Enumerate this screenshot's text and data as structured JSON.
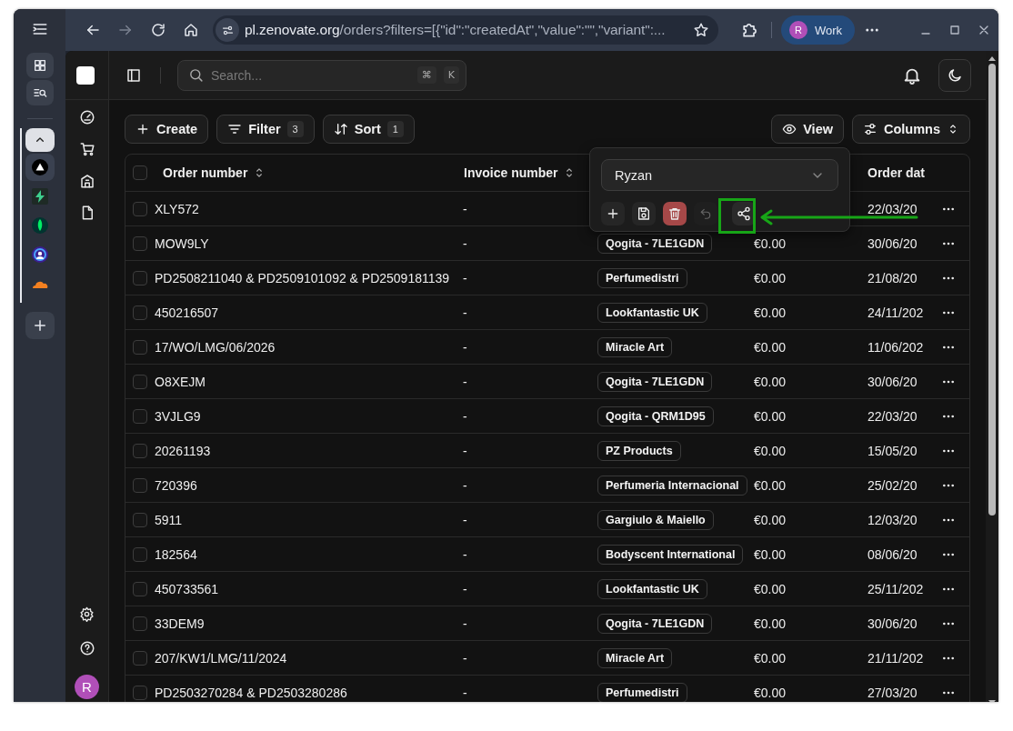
{
  "browser": {
    "forward_disabled": true,
    "url": {
      "host": "pl.zenovate.org",
      "rest": "/orders?filters=[{\"id\":\"createdAt\",\"value\":\"\",\"variant\":..."
    },
    "profile": {
      "initial": "R",
      "label": "Work"
    }
  },
  "side_panel": {
    "apps": [
      {
        "kind": "triangle",
        "selected": true
      },
      {
        "kind": "bolt",
        "selected": false
      },
      {
        "kind": "leaf",
        "selected": false
      },
      {
        "kind": "ring",
        "selected": false
      },
      {
        "kind": "cloud",
        "selected": false
      }
    ]
  },
  "app_sidebar": {
    "user_initial": "R"
  },
  "search": {
    "placeholder": "Search...",
    "keys": [
      "⌘",
      "K"
    ]
  },
  "toolbar": {
    "create": "Create",
    "filter": {
      "label": "Filter",
      "count": "3"
    },
    "sort": {
      "label": "Sort",
      "count": "1"
    },
    "view": "View",
    "columns": "Columns"
  },
  "table": {
    "all_checked": false,
    "header": {
      "order_number": "Order number",
      "invoice_number": "Invoice number",
      "column_5": "Order dat"
    },
    "rows": [
      {
        "order": "XLY572",
        "invoice": "-",
        "date": "22/03/20",
        "checked": false
      },
      {
        "order": "MOW9LY",
        "invoice": "-",
        "supplier": "Qogita - 7LE1GDN",
        "amount": "€0.00",
        "date": "30/06/20",
        "checked": false
      },
      {
        "order": "PD2508211040 & PD2509101092 & PD2509181139",
        "invoice": "-",
        "supplier": "Perfumedistri",
        "amount": "€0.00",
        "date": "21/08/20",
        "checked": false
      },
      {
        "order": "450216507",
        "invoice": "-",
        "supplier": "Lookfantastic UK",
        "amount": "€0.00",
        "date": "24/11/202",
        "checked": false
      },
      {
        "order": "17/WO/LMG/06/2026",
        "invoice": "-",
        "supplier": "Miracle Art",
        "amount": "€0.00",
        "date": "11/06/202",
        "checked": false
      },
      {
        "order": "O8XEJM",
        "invoice": "-",
        "supplier": "Qogita - 7LE1GDN",
        "amount": "€0.00",
        "date": "30/06/20",
        "checked": false
      },
      {
        "order": "3VJLG9",
        "invoice": "-",
        "supplier": "Qogita - QRM1D95",
        "amount": "€0.00",
        "date": "22/03/20",
        "checked": false
      },
      {
        "order": "20261193",
        "invoice": "-",
        "supplier": "PZ Products",
        "amount": "€0.00",
        "date": "15/05/20",
        "checked": false
      },
      {
        "order": "720396",
        "invoice": "-",
        "supplier": "Perfumeria Internacional",
        "amount": "€0.00",
        "date": "25/02/20",
        "checked": false
      },
      {
        "order": "5911",
        "invoice": "-",
        "supplier": "Gargiulo & Maiello",
        "amount": "€0.00",
        "date": "12/03/20",
        "checked": false
      },
      {
        "order": "182564",
        "invoice": "-",
        "supplier": "Bodyscent International",
        "amount": "€0.00",
        "date": "08/06/20",
        "checked": false
      },
      {
        "order": "450733561",
        "invoice": "-",
        "supplier": "Lookfantastic UK",
        "amount": "€0.00",
        "date": "25/11/202",
        "checked": false
      },
      {
        "order": "33DEM9",
        "invoice": "-",
        "supplier": "Qogita - 7LE1GDN",
        "amount": "€0.00",
        "date": "30/06/20",
        "checked": false
      },
      {
        "order": "207/KW1/LMG/11/2024",
        "invoice": "-",
        "supplier": "Miracle Art",
        "amount": "€0.00",
        "date": "21/11/202",
        "checked": false
      },
      {
        "order": "PD2503270284 & PD2503280286",
        "invoice": "-",
        "supplier": "Perfumedistri",
        "amount": "€0.00",
        "date": "27/03/20",
        "checked": false
      }
    ]
  },
  "views_popover": {
    "selected_view": "Ryzan",
    "undo_disabled": true
  }
}
